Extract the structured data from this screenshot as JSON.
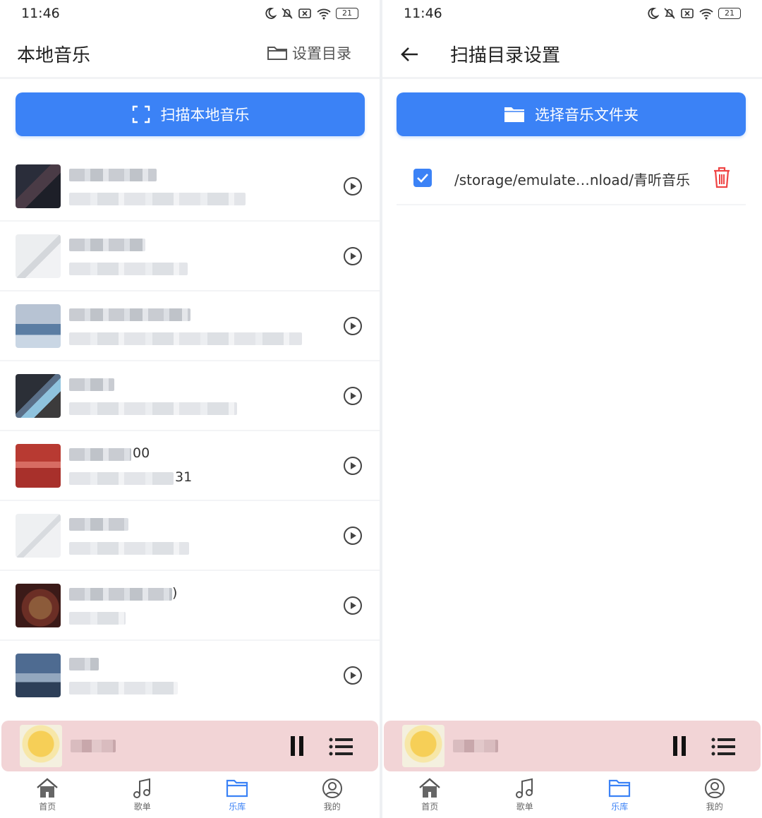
{
  "status_bar": {
    "time": "11:46",
    "battery": "21"
  },
  "local_music": {
    "title": "本地音乐",
    "set_dir_label": "设置目录",
    "scan_button_label": "扫描本地音乐",
    "songs": [
      {
        "tail_title": "",
        "tail_sub": ""
      },
      {
        "tail_title": "",
        "tail_sub": ""
      },
      {
        "tail_title": "",
        "tail_sub": ""
      },
      {
        "tail_title": "",
        "tail_sub": ""
      },
      {
        "tail_title": "00",
        "tail_sub": "31"
      },
      {
        "tail_title": "",
        "tail_sub": ""
      },
      {
        "tail_title": ")",
        "tail_sub": ""
      },
      {
        "tail_title": "",
        "tail_sub": ""
      }
    ]
  },
  "scan_settings": {
    "title": "扫描目录设置",
    "select_folder_label": "选择音乐文件夹",
    "folders": [
      {
        "path": "/storage/emulate…nload/青听音乐",
        "checked": true
      }
    ]
  },
  "tabbar": {
    "items": [
      {
        "label": "首页",
        "icon": "home-icon"
      },
      {
        "label": "歌单",
        "icon": "music-note-icon"
      },
      {
        "label": "乐库",
        "icon": "folder-icon",
        "active": true
      },
      {
        "label": "我的",
        "icon": "user-icon"
      }
    ]
  },
  "colors": {
    "accent": "#3b82f6",
    "player_bg": "#f2d4d6",
    "delete": "#ef4444"
  }
}
